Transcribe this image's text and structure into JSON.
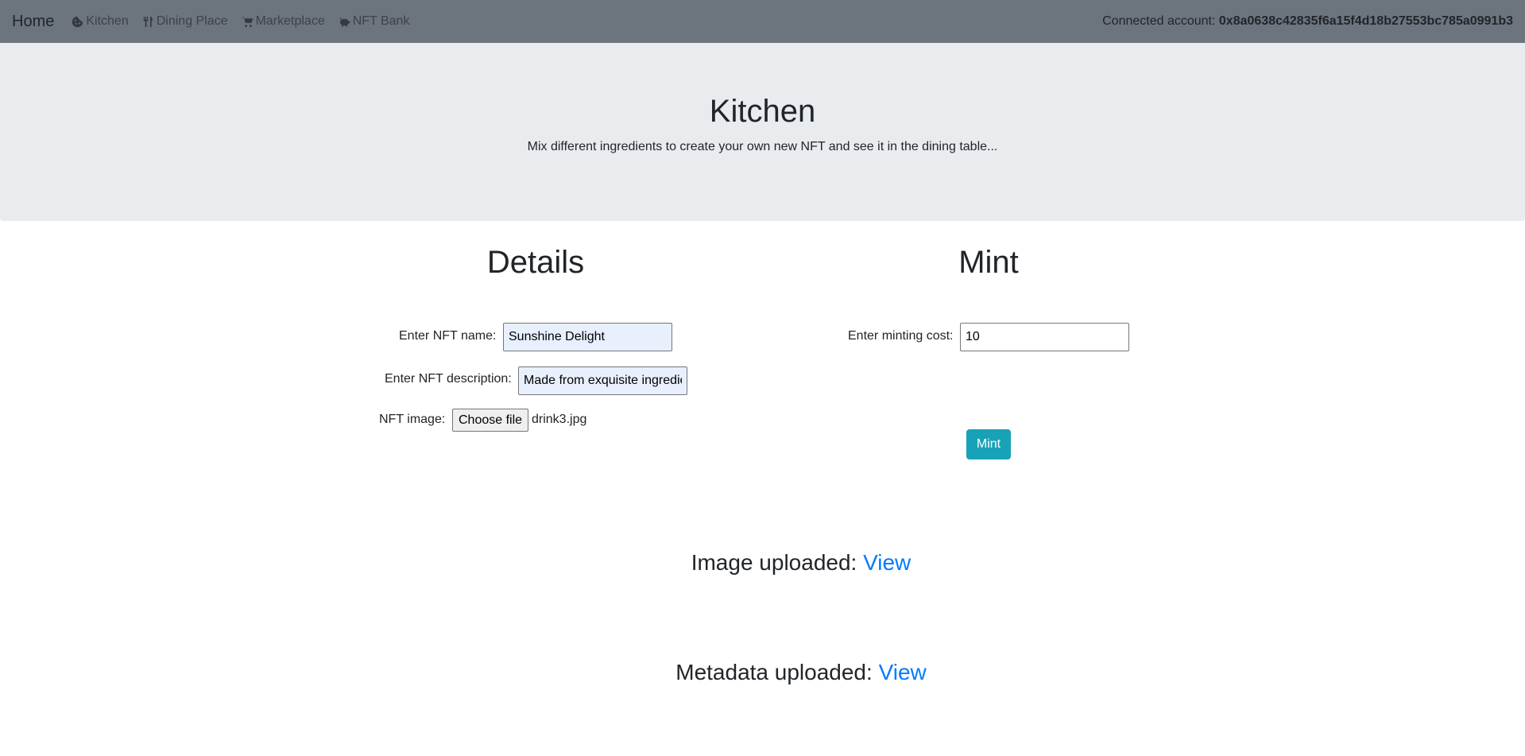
{
  "navbar": {
    "brand": "Home",
    "items": [
      {
        "label": "Kitchen",
        "icon": "cookie-icon"
      },
      {
        "label": "Dining Place",
        "icon": "utensils-icon"
      },
      {
        "label": "Marketplace",
        "icon": "cart-icon"
      },
      {
        "label": "NFT Bank",
        "icon": "piggy-bank-icon"
      }
    ],
    "account_label": "Connected account:",
    "account_address": "0x8a0638c42835f6a15f4d18b27553bc785a0991b3"
  },
  "jumbotron": {
    "title": "Kitchen",
    "subtitle": "Mix different ingredients to create your own new NFT and see it in the dining table..."
  },
  "details": {
    "title": "Details",
    "name_label": "Enter NFT name:",
    "name_value": "Sunshine Delight",
    "description_label": "Enter NFT description:",
    "description_value": "Made from exquisite ingredients",
    "image_label": "NFT image:",
    "file_button": "Choose file",
    "file_name": "drink3.jpg"
  },
  "mint": {
    "title": "Mint",
    "cost_label": "Enter minting cost:",
    "cost_value": "10",
    "button": "Mint"
  },
  "uploads": {
    "image_label": "Image uploaded:",
    "image_link": "View",
    "metadata_label": "Metadata uploaded:",
    "metadata_link": "View"
  },
  "colors": {
    "navbar": "#6c757d",
    "jumbotron": "#e9ecef",
    "mint_button": "#17a2b8",
    "link": "#007bff"
  }
}
